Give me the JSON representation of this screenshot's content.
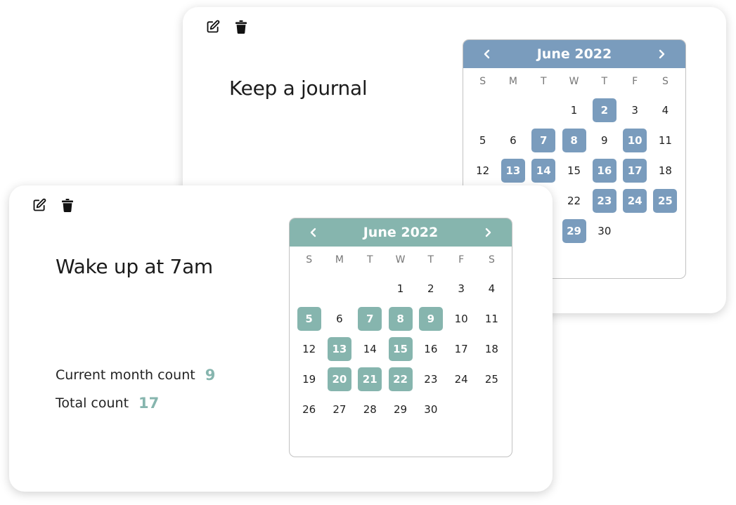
{
  "weekday_labels": [
    "S",
    "M",
    "T",
    "W",
    "T",
    "F",
    "S"
  ],
  "habits": [
    {
      "id": "journal",
      "title": "Keep a journal",
      "accent": "#7a9cbd",
      "calendar": {
        "month_label": "June 2022",
        "first_weekday": 3,
        "days_in_month": 30,
        "completed_days": [
          2,
          7,
          8,
          10,
          13,
          14,
          16,
          17,
          23,
          24,
          25,
          29
        ]
      }
    },
    {
      "id": "wake",
      "title": "Wake up at 7am",
      "accent": "#86b5ae",
      "stats": {
        "current_month_label": "Current month count",
        "current_month_value": "9",
        "total_label": "Total count",
        "total_value": "17"
      },
      "calendar": {
        "month_label": "June 2022",
        "first_weekday": 3,
        "days_in_month": 30,
        "completed_days": [
          5,
          7,
          8,
          9,
          13,
          15,
          20,
          21,
          22
        ]
      }
    }
  ],
  "icons": {
    "edit": "edit-icon",
    "delete": "trash-icon",
    "prev": "chevron-left-icon",
    "next": "chevron-right-icon"
  }
}
